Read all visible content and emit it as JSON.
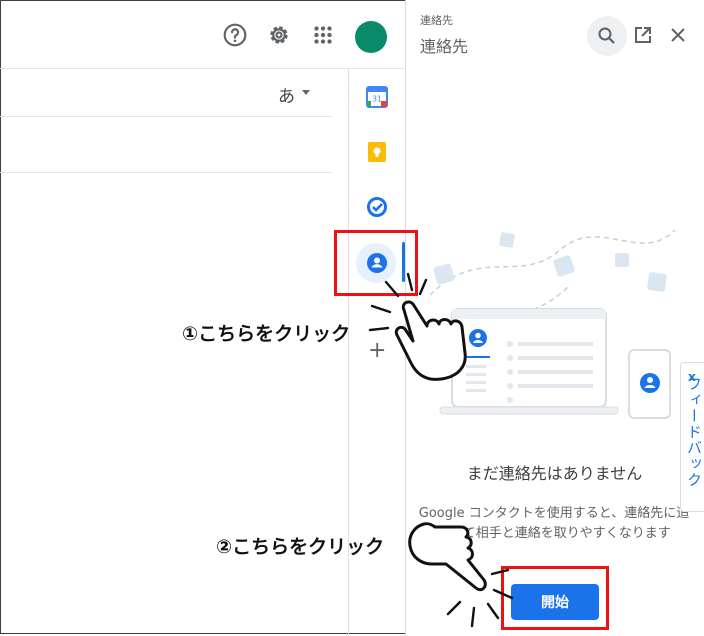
{
  "topbar": {
    "icons": [
      "help-icon",
      "settings-icon",
      "apps-grid-icon"
    ],
    "avatar_color": "#098a6b"
  },
  "compose": {
    "ime_label": "あ"
  },
  "side_panel": {
    "calendar_day": "31",
    "icons": [
      "calendar-icon",
      "keep-icon",
      "tasks-icon",
      "contacts-icon",
      "plus-icon"
    ]
  },
  "contacts_panel": {
    "small_label": "連絡先",
    "title": "連絡先",
    "empty_title": "まだ連絡先はありません",
    "description": "Google コンタクトを使用すると、連絡先に追加して相手と連絡を取りやすくなります",
    "start_button": "開始",
    "feedback_label": "フィードバック",
    "feedback_close": "x"
  },
  "annotations": {
    "step1": "①こちらをクリック",
    "step2": "②こちらをクリック",
    "highlight_color": "#ee1111"
  },
  "colors": {
    "accent": "#1a73e8"
  }
}
